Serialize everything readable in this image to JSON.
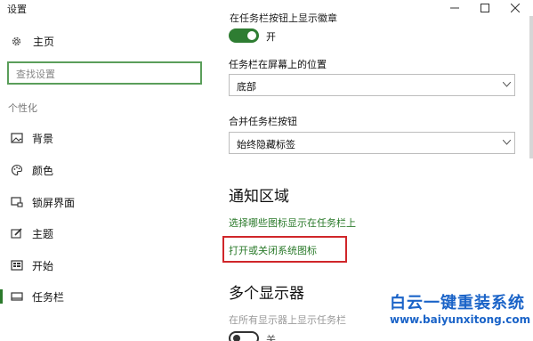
{
  "window": {
    "title": "设置"
  },
  "sidebar": {
    "home_label": "主页",
    "search_placeholder": "查找设置",
    "section_label": "个性化",
    "items": [
      {
        "label": "背景",
        "icon": "image-icon"
      },
      {
        "label": "颜色",
        "icon": "palette-icon"
      },
      {
        "label": "锁屏界面",
        "icon": "lock-screen-icon"
      },
      {
        "label": "主题",
        "icon": "brush-icon"
      },
      {
        "label": "开始",
        "icon": "start-menu-icon"
      },
      {
        "label": "任务栏",
        "icon": "taskbar-icon",
        "active": true
      }
    ]
  },
  "main": {
    "cut_text": "在任务栏按钮上显示徽章",
    "badge_toggle": {
      "state": "on",
      "label": "开"
    },
    "position": {
      "label": "任务栏在屏幕上的位置",
      "value": "底部"
    },
    "combine": {
      "label": "合并任务栏按钮",
      "value": "始终隐藏标签"
    },
    "notification": {
      "heading": "通知区域",
      "link1": "选择哪些图标显示在任务栏上",
      "link2": "打开或关闭系统图标"
    },
    "multi_display": {
      "heading": "多个显示器",
      "label": "在所有显示器上显示任务栏",
      "toggle": {
        "state": "off",
        "label": "关"
      }
    }
  },
  "watermark": {
    "title": "白云一键重装系统",
    "url": "www.baiyunxitong.com"
  },
  "colors": {
    "accent": "#2e7d32",
    "link": "#2a7a2a",
    "highlight": "#d0262a",
    "watermark": "#1b64c8"
  }
}
